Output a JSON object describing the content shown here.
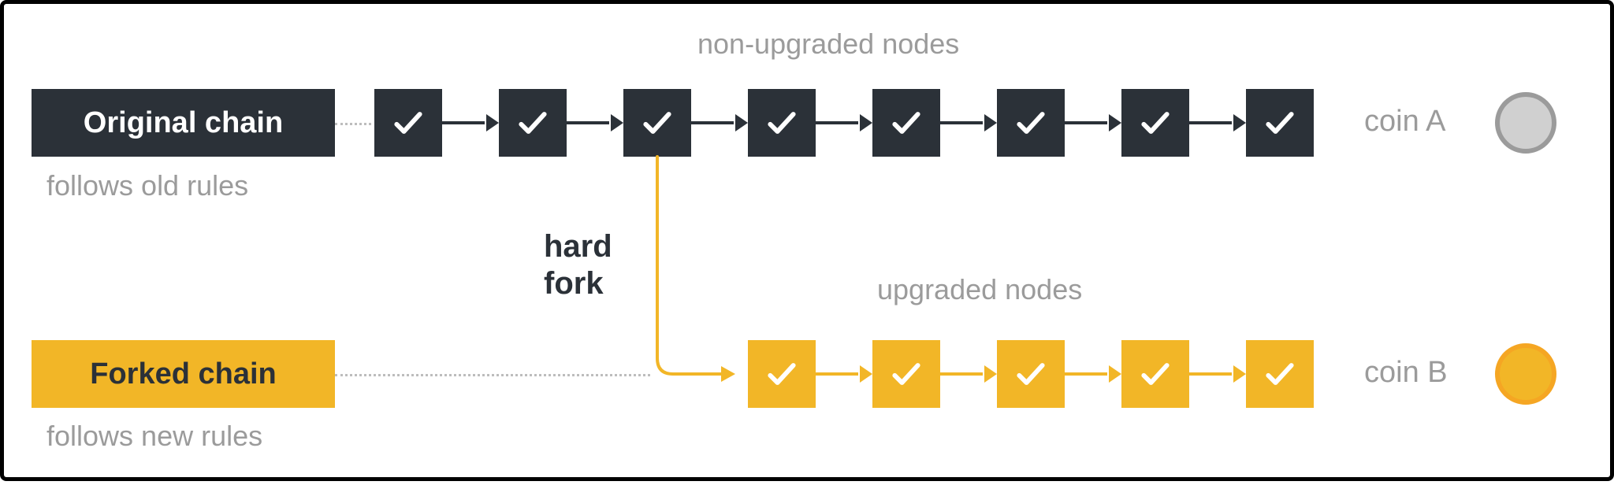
{
  "labels": {
    "non_upgraded": "non-upgraded nodes",
    "upgraded": "upgraded nodes",
    "hard_fork_l1": "hard",
    "hard_fork_l2": "fork"
  },
  "original": {
    "title": "Original chain",
    "subtitle": "follows old rules",
    "coin": "coin A"
  },
  "forked": {
    "title": "Forked chain",
    "subtitle": "follows new rules",
    "coin": "coin B"
  },
  "colors": {
    "dark": "#2b3138",
    "gold": "#f2b627",
    "gray": "#9b9b9b"
  }
}
